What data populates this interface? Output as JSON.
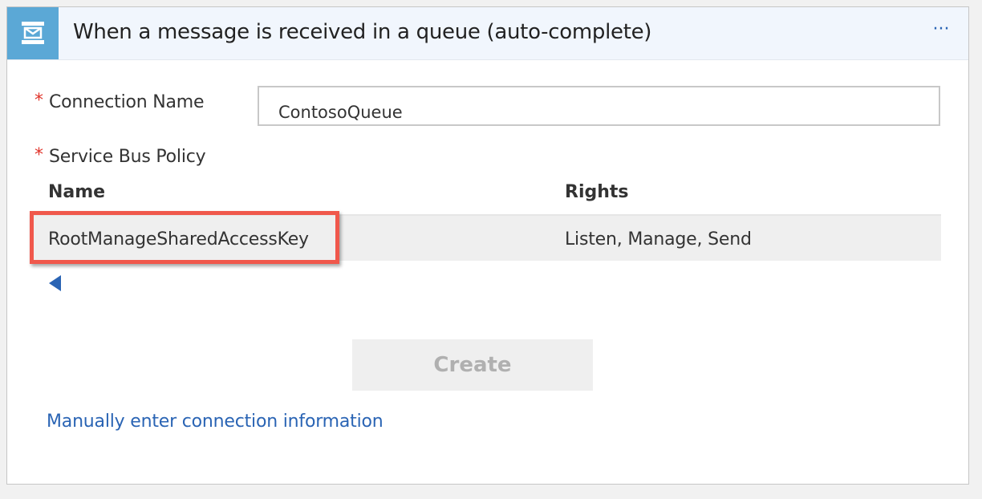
{
  "header": {
    "title": "When a message is received in a queue (auto-complete)",
    "icon": "service-bus-icon",
    "more_label": "···"
  },
  "form": {
    "required_marker": "*",
    "connection_name_label": "Connection Name",
    "connection_name_value": "ContosoQueue",
    "policy_label": "Service Bus Policy"
  },
  "policy_table": {
    "columns": [
      "Name",
      "Rights"
    ],
    "rows": [
      {
        "name": "RootManageSharedAccessKey",
        "rights": "Listen, Manage, Send"
      }
    ]
  },
  "actions": {
    "create_label": "Create",
    "manual_link": "Manually enter connection information"
  },
  "colors": {
    "accent": "#2a64b4",
    "header_icon_bg": "#5ba8d6",
    "required": "#e0342b",
    "highlight": "#f0584c"
  }
}
